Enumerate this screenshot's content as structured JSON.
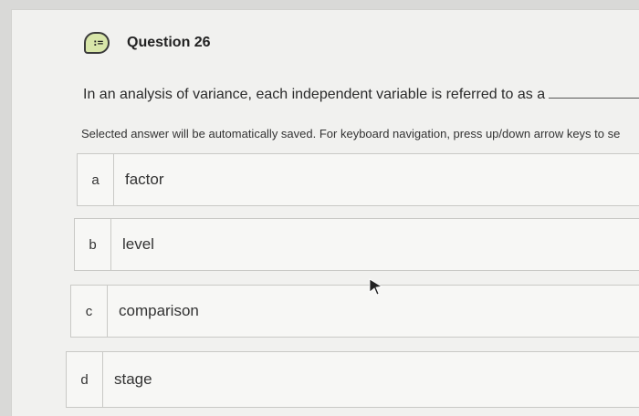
{
  "question": {
    "icon": "question-list-icon",
    "title": "Question 26",
    "text": "In an analysis of variance, each independent variable is referred to as a",
    "instructions": "Selected answer will be automatically saved. For keyboard navigation, press up/down arrow keys to se"
  },
  "options": [
    {
      "letter": "a",
      "label": "factor"
    },
    {
      "letter": "b",
      "label": "level"
    },
    {
      "letter": "c",
      "label": "comparison"
    },
    {
      "letter": "d",
      "label": "stage"
    }
  ]
}
